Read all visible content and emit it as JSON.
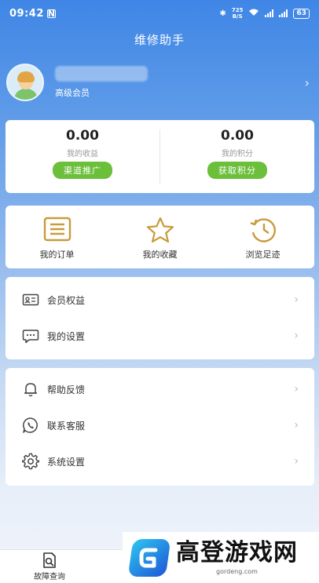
{
  "status_bar": {
    "time": "09:42",
    "net_speed_value": "725",
    "net_speed_unit": "B/S",
    "battery": "63"
  },
  "app": {
    "title": "维修助手"
  },
  "profile": {
    "member_level": "高级会员"
  },
  "earnings": {
    "income_value": "0.00",
    "income_label": "我的收益",
    "income_button": "渠道推广",
    "points_value": "0.00",
    "points_label": "我的积分",
    "points_button": "获取积分"
  },
  "shortcuts": [
    {
      "label": "我的订单",
      "icon": "order-list-icon"
    },
    {
      "label": "我的收藏",
      "icon": "star-icon"
    },
    {
      "label": "浏览足迹",
      "icon": "history-clock-icon"
    }
  ],
  "menu_group_1": [
    {
      "label": "会员权益",
      "icon": "member-card-icon"
    },
    {
      "label": "我的设置",
      "icon": "chat-bubble-icon"
    }
  ],
  "menu_group_2": [
    {
      "label": "帮助反馈",
      "icon": "bell-icon"
    },
    {
      "label": "联系客服",
      "icon": "phone-chat-icon"
    },
    {
      "label": "系统设置",
      "icon": "gear-icon"
    }
  ],
  "tab_bar": {
    "tab1_label": "故障查询"
  },
  "watermark": {
    "brand": "高登游戏网",
    "url": "gordeng.com"
  },
  "colors": {
    "accent_blue": "#3f86e6",
    "button_green": "#6cbf3b",
    "icon_gold": "#c89b3c"
  }
}
